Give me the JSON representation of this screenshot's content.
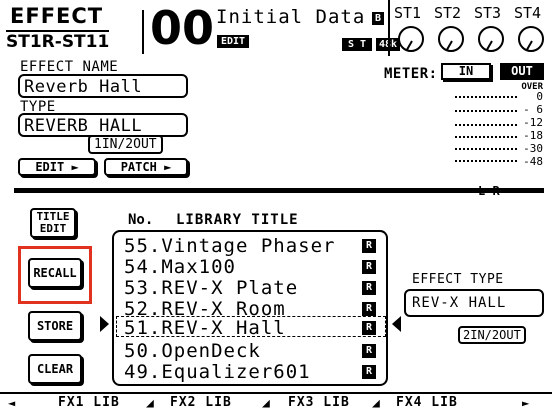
{
  "header": {
    "effect_label": "EFFECT",
    "channel_label": "ST1R-ST11",
    "scene_number": "00",
    "scene_name": "Initial Data",
    "edit_badge": "EDIT",
    "st_badge": "S T",
    "rate_badge": "48k",
    "fs_icon": "B",
    "knob_labels": [
      "ST1",
      "ST2",
      "ST3",
      "ST4"
    ]
  },
  "effect": {
    "name_label": "EFFECT NAME",
    "name_value": "Reverb Hall",
    "type_label": "TYPE",
    "type_value": "REVERB HALL",
    "io_config": "1IN/2OUT",
    "edit_button": "EDIT",
    "patch_button": "PATCH"
  },
  "meter": {
    "label": "METER:",
    "in_label": "IN",
    "out_label": "OUT",
    "over_label": "OVER",
    "scale": [
      "0",
      "- 6",
      "-12",
      "-18",
      "-30",
      "-48"
    ],
    "channels": "L R"
  },
  "library": {
    "no_header": "No.",
    "title_header": "LIBRARY TITLE",
    "title_edit_button": [
      "TITLE",
      "EDIT"
    ],
    "recall_button": "RECALL",
    "store_button": "STORE",
    "clear_button": "CLEAR",
    "items": [
      {
        "label": "55.Vintage Phaser",
        "badge": "R"
      },
      {
        "label": "54.Max100",
        "badge": "R"
      },
      {
        "label": "53.REV-X Plate",
        "badge": "R"
      },
      {
        "label": "52.REV-X Room",
        "badge": "R"
      },
      {
        "label": "51.REV-X Hall",
        "badge": "R"
      },
      {
        "label": "50.OpenDeck",
        "badge": "R"
      },
      {
        "label": "49.Equalizer601",
        "badge": "R"
      }
    ],
    "selected_index": 4,
    "effect_type_label": "EFFECT TYPE",
    "effect_type_value": "REV-X HALL",
    "effect_type_io": "2IN/2OUT"
  },
  "tabs": [
    "FX1 LIB",
    "FX2 LIB",
    "FX3 LIB",
    "FX4 LIB"
  ],
  "colors": {
    "highlight": "#e0321e",
    "ink": "#000000",
    "paper": "#ffffff"
  }
}
